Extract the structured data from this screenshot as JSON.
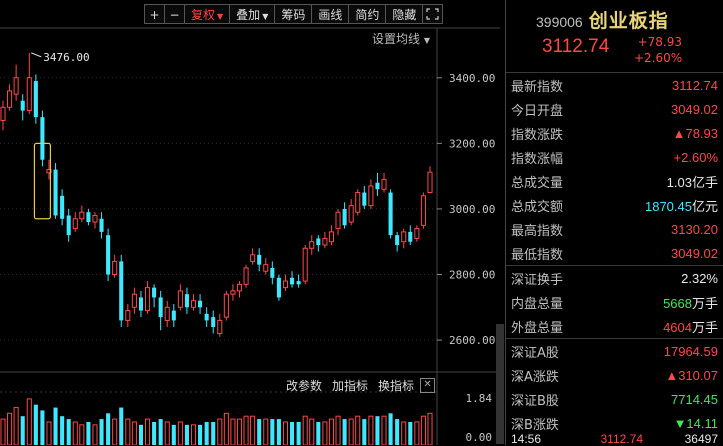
{
  "toolbar": {
    "plus": "+",
    "minus": "−",
    "fuquan": "复权",
    "diejia": "叠加",
    "chouma": "筹码",
    "huaxian": "画线",
    "jianyue": "简约",
    "yincang": "隐藏",
    "fullscreen_icon": "expand-icon"
  },
  "chart": {
    "ma_setting": "设置均线",
    "peak_label": "3476.00",
    "y_ticks": [
      "3400.00",
      "3200.00",
      "3000.00",
      "2800.00",
      "2600.00"
    ],
    "bottom_bar": {
      "gaicanshu": "改参数",
      "jiazhibiao": "加指标",
      "huanzhibiao": "换指标",
      "close": "✕"
    },
    "vol_ticks": [
      "1.84",
      "0.00"
    ],
    "colors": {
      "up": "#ff4848",
      "down": "#40e8ff"
    }
  },
  "chart_data": {
    "type": "candlestick",
    "y_ticks": [
      3400,
      3200,
      3000,
      2800,
      2600
    ],
    "ylim": [
      2585,
      3500
    ],
    "candles": [
      {
        "o": 3270,
        "c": 3310,
        "h": 3330,
        "l": 3240
      },
      {
        "o": 3310,
        "c": 3360,
        "h": 3380,
        "l": 3300
      },
      {
        "o": 3350,
        "c": 3400,
        "h": 3440,
        "l": 3330
      },
      {
        "o": 3330,
        "c": 3300,
        "h": 3350,
        "l": 3270
      },
      {
        "o": 3300,
        "c": 3400,
        "h": 3476,
        "l": 3290
      },
      {
        "o": 3390,
        "c": 3280,
        "h": 3410,
        "l": 3260
      },
      {
        "o": 3280,
        "c": 3150,
        "h": 3300,
        "l": 3130
      },
      {
        "o": 3110,
        "c": 3120,
        "h": 3150,
        "l": 3090
      },
      {
        "o": 3120,
        "c": 2980,
        "h": 3140,
        "l": 2970
      },
      {
        "o": 3040,
        "c": 2970,
        "h": 3060,
        "l": 2950
      },
      {
        "o": 2980,
        "c": 2920,
        "h": 3000,
        "l": 2900
      },
      {
        "o": 2940,
        "c": 2970,
        "h": 2990,
        "l": 2930
      },
      {
        "o": 2970,
        "c": 2990,
        "h": 3010,
        "l": 2960
      },
      {
        "o": 2990,
        "c": 2960,
        "h": 3000,
        "l": 2950
      },
      {
        "o": 2960,
        "c": 2980,
        "h": 2990,
        "l": 2940
      },
      {
        "o": 2970,
        "c": 2930,
        "h": 2990,
        "l": 2910
      },
      {
        "o": 2920,
        "c": 2800,
        "h": 2940,
        "l": 2780
      },
      {
        "o": 2800,
        "c": 2840,
        "h": 2860,
        "l": 2790
      },
      {
        "o": 2840,
        "c": 2660,
        "h": 2860,
        "l": 2640
      },
      {
        "o": 2660,
        "c": 2690,
        "h": 2710,
        "l": 2640
      },
      {
        "o": 2700,
        "c": 2740,
        "h": 2760,
        "l": 2680
      },
      {
        "o": 2730,
        "c": 2690,
        "h": 2750,
        "l": 2670
      },
      {
        "o": 2690,
        "c": 2760,
        "h": 2780,
        "l": 2680
      },
      {
        "o": 2760,
        "c": 2730,
        "h": 2770,
        "l": 2700
      },
      {
        "o": 2730,
        "c": 2670,
        "h": 2750,
        "l": 2630
      },
      {
        "o": 2660,
        "c": 2700,
        "h": 2720,
        "l": 2640
      },
      {
        "o": 2690,
        "c": 2660,
        "h": 2710,
        "l": 2640
      },
      {
        "o": 2700,
        "c": 2750,
        "h": 2770,
        "l": 2690
      },
      {
        "o": 2740,
        "c": 2700,
        "h": 2760,
        "l": 2680
      },
      {
        "o": 2700,
        "c": 2720,
        "h": 2740,
        "l": 2690
      },
      {
        "o": 2720,
        "c": 2700,
        "h": 2740,
        "l": 2680
      },
      {
        "o": 2680,
        "c": 2660,
        "h": 2700,
        "l": 2640
      },
      {
        "o": 2670,
        "c": 2640,
        "h": 2690,
        "l": 2620
      },
      {
        "o": 2620,
        "c": 2660,
        "h": 2680,
        "l": 2610
      },
      {
        "o": 2670,
        "c": 2740,
        "h": 2750,
        "l": 2660
      },
      {
        "o": 2740,
        "c": 2750,
        "h": 2770,
        "l": 2720
      },
      {
        "o": 2750,
        "c": 2770,
        "h": 2780,
        "l": 2730
      },
      {
        "o": 2770,
        "c": 2820,
        "h": 2830,
        "l": 2760
      },
      {
        "o": 2840,
        "c": 2860,
        "h": 2880,
        "l": 2830
      },
      {
        "o": 2860,
        "c": 2830,
        "h": 2880,
        "l": 2810
      },
      {
        "o": 2810,
        "c": 2830,
        "h": 2850,
        "l": 2800
      },
      {
        "o": 2820,
        "c": 2790,
        "h": 2840,
        "l": 2770
      },
      {
        "o": 2790,
        "c": 2730,
        "h": 2800,
        "l": 2720
      },
      {
        "o": 2760,
        "c": 2780,
        "h": 2800,
        "l": 2750
      },
      {
        "o": 2790,
        "c": 2770,
        "h": 2810,
        "l": 2760
      },
      {
        "o": 2780,
        "c": 2770,
        "h": 2800,
        "l": 2760
      },
      {
        "o": 2780,
        "c": 2880,
        "h": 2890,
        "l": 2770
      },
      {
        "o": 2880,
        "c": 2900,
        "h": 2920,
        "l": 2860
      },
      {
        "o": 2910,
        "c": 2890,
        "h": 2920,
        "l": 2870
      },
      {
        "o": 2890,
        "c": 2910,
        "h": 2930,
        "l": 2880
      },
      {
        "o": 2900,
        "c": 2930,
        "h": 2950,
        "l": 2890
      },
      {
        "o": 2940,
        "c": 2990,
        "h": 3000,
        "l": 2920
      },
      {
        "o": 3000,
        "c": 2950,
        "h": 3020,
        "l": 2940
      },
      {
        "o": 2960,
        "c": 3010,
        "h": 3030,
        "l": 2950
      },
      {
        "o": 2990,
        "c": 3050,
        "h": 3060,
        "l": 2980
      },
      {
        "o": 3050,
        "c": 3010,
        "h": 3070,
        "l": 3000
      },
      {
        "o": 3010,
        "c": 3070,
        "h": 3090,
        "l": 3000
      },
      {
        "o": 3080,
        "c": 3060,
        "h": 3110,
        "l": 3040
      },
      {
        "o": 3060,
        "c": 3090,
        "h": 3110,
        "l": 3050
      },
      {
        "o": 3050,
        "c": 2920,
        "h": 3060,
        "l": 2910
      },
      {
        "o": 2920,
        "c": 2890,
        "h": 2930,
        "l": 2870
      },
      {
        "o": 2900,
        "c": 2930,
        "h": 2940,
        "l": 2880
      },
      {
        "o": 2930,
        "c": 2900,
        "h": 2950,
        "l": 2890
      },
      {
        "o": 2910,
        "c": 2940,
        "h": 2950,
        "l": 2900
      },
      {
        "o": 2950,
        "c": 3040,
        "h": 3050,
        "l": 2940
      },
      {
        "o": 3050,
        "c": 3112,
        "h": 3130,
        "l": 3049
      }
    ],
    "volumes": [
      0.9,
      1.1,
      1.3,
      1.0,
      1.6,
      1.4,
      1.2,
      0.8,
      1.3,
      1.0,
      0.9,
      0.8,
      0.7,
      0.8,
      0.7,
      0.9,
      1.1,
      0.9,
      1.3,
      0.9,
      0.8,
      0.7,
      0.9,
      0.8,
      0.9,
      0.8,
      0.7,
      0.8,
      0.7,
      0.7,
      0.7,
      0.8,
      0.8,
      0.9,
      1.1,
      0.9,
      0.9,
      1.0,
      1.0,
      0.9,
      0.9,
      0.9,
      0.9,
      0.8,
      0.8,
      0.8,
      1.0,
      0.9,
      0.8,
      0.8,
      0.9,
      1.0,
      0.9,
      0.9,
      1.0,
      0.9,
      1.0,
      1.0,
      1.0,
      1.1,
      0.9,
      0.8,
      0.8,
      0.8,
      1.0,
      1.1
    ],
    "vol_ylim": [
      0,
      1.84
    ]
  },
  "info": {
    "code": "399006",
    "name": "创业板指",
    "price": "3112.74",
    "change": "+78.93",
    "change_pct": "+2.60%",
    "rows": [
      {
        "label": "最新指数",
        "value": "3112.74",
        "color": "red"
      },
      {
        "label": "今日开盘",
        "value": "3049.02",
        "color": "red"
      },
      {
        "label": "指数涨跌",
        "value": "▲78.93",
        "color": "red"
      },
      {
        "label": "指数涨幅",
        "value": "+2.60%",
        "color": "red"
      },
      {
        "label": "总成交量",
        "value": "1.03",
        "unit": "亿手",
        "color": "white"
      },
      {
        "label": "总成交额",
        "value": "1870.45",
        "unit": "亿元",
        "color": "cyan"
      },
      {
        "label": "最高指数",
        "value": "3130.20",
        "color": "red"
      },
      {
        "label": "最低指数",
        "value": "3049.02",
        "color": "red"
      }
    ],
    "rows2": [
      {
        "label": "深证换手",
        "value": "2.32%",
        "color": "white"
      },
      {
        "label": "内盘总量",
        "value": "5668",
        "unit": "万手",
        "color": "green"
      },
      {
        "label": "外盘总量",
        "value": "4604",
        "unit": "万手",
        "color": "red"
      }
    ],
    "rows3": [
      {
        "label": "深证A股",
        "value": "17964.59",
        "color": "red"
      },
      {
        "label": "深A涨跌",
        "value": "▲310.07",
        "color": "red"
      },
      {
        "label": "深证B股",
        "value": "7714.45",
        "color": "green"
      },
      {
        "label": "深B涨跌",
        "value": "▼14.11",
        "color": "green"
      }
    ],
    "tick": {
      "time": "14:56",
      "price": "3112.74",
      "vol": "36497"
    }
  }
}
